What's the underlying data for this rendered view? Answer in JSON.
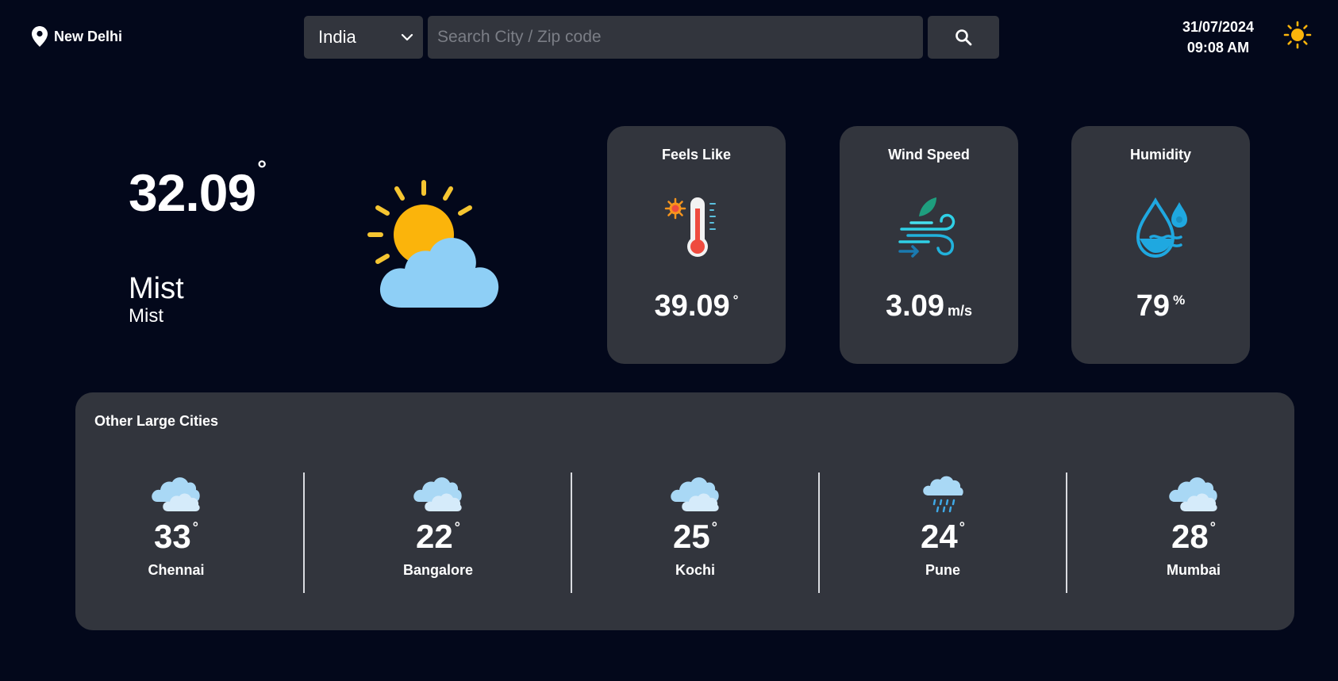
{
  "header": {
    "location": "New Delhi",
    "location_icon": "map-pin-icon",
    "country_select": {
      "value": "India",
      "options": [
        "India"
      ]
    },
    "search": {
      "placeholder": "Search City / Zip code",
      "value": ""
    },
    "date": "31/07/2024",
    "time": "09:08 AM",
    "theme_icon": "sun-icon"
  },
  "current": {
    "temperature": "32.09",
    "degree": "°",
    "condition": "Mist",
    "description": "Mist",
    "icon": "partly-cloudy-sun-icon"
  },
  "stats": {
    "feels_like": {
      "label": "Feels Like",
      "value": "39.09",
      "unit": "°",
      "icon": "thermometer-icon"
    },
    "wind_speed": {
      "label": "Wind Speed",
      "value": "3.09",
      "unit": "m/s",
      "icon": "wind-icon"
    },
    "humidity": {
      "label": "Humidity",
      "value": "79",
      "unit": "%",
      "icon": "humidity-drops-icon"
    }
  },
  "other_cities": {
    "title": "Other Large Cities",
    "degree": "°",
    "cities": [
      {
        "name": "Chennai",
        "temp": "33",
        "icon": "cloudy-icon"
      },
      {
        "name": "Bangalore",
        "temp": "22",
        "icon": "cloudy-icon"
      },
      {
        "name": "Kochi",
        "temp": "25",
        "icon": "cloudy-icon"
      },
      {
        "name": "Pune",
        "temp": "24",
        "icon": "rain-cloud-icon"
      },
      {
        "name": "Mumbai",
        "temp": "28",
        "icon": "cloudy-icon"
      }
    ]
  },
  "colors": {
    "background": "#03081b",
    "panel": "#32353d",
    "sun": "#fbb40b",
    "cloud": "#8ecff6"
  }
}
